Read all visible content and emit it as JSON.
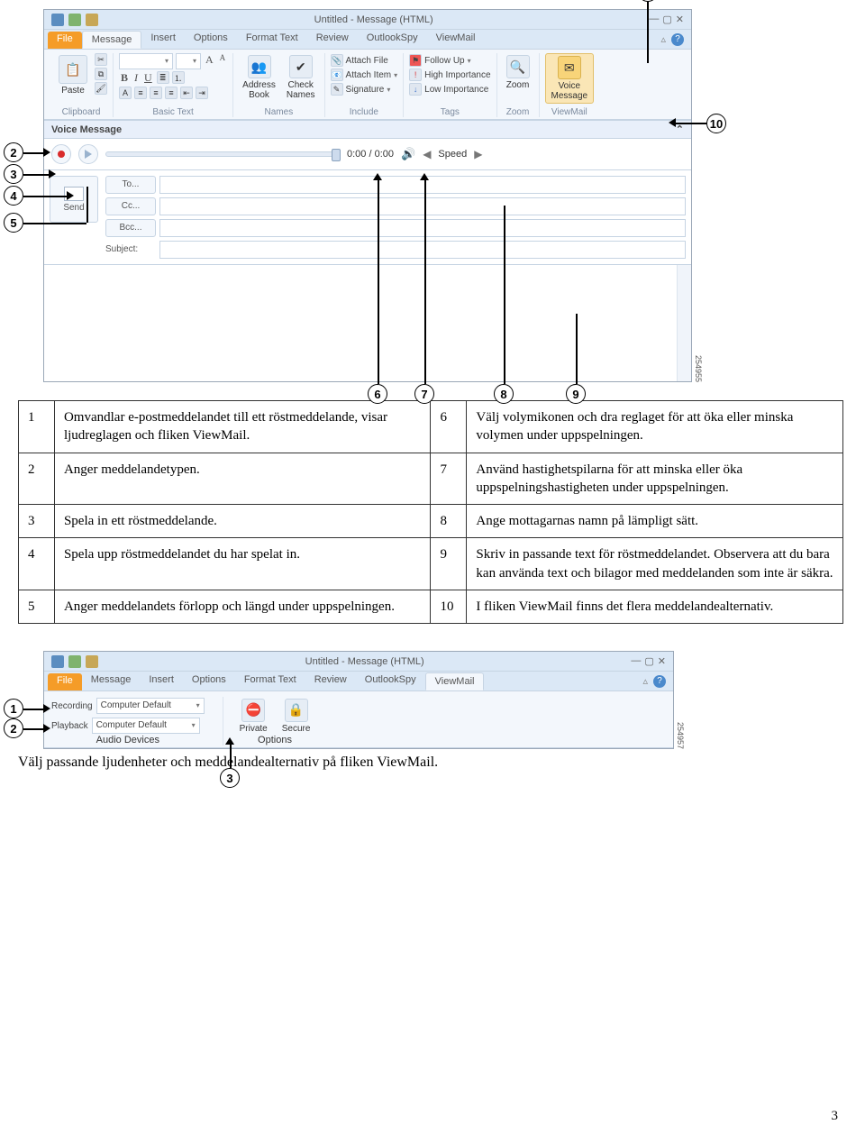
{
  "shot1": {
    "window_title": "Untitled - Message (HTML)",
    "tabs": {
      "file": "File",
      "message": "Message",
      "insert": "Insert",
      "options": "Options",
      "format_text": "Format Text",
      "review": "Review",
      "outlookspy": "OutlookSpy",
      "viewmail": "ViewMail"
    },
    "ribbon": {
      "clipboard": "Clipboard",
      "paste": "Paste",
      "basic_text": "Basic Text",
      "names": "Names",
      "address_book": "Address\nBook",
      "check_names": "Check\nNames",
      "include": "Include",
      "attach_file": "Attach File",
      "attach_item": "Attach Item",
      "signature": "Signature",
      "tags": "Tags",
      "follow_up": "Follow Up",
      "high_importance": "High Importance",
      "low_importance": "Low Importance",
      "zoom": "Zoom",
      "viewmail": "ViewMail",
      "voice_message": "Voice\nMessage"
    },
    "voice_header": "Voice Message",
    "player": {
      "time": "0:00 / 0:00",
      "speed": "Speed"
    },
    "fields": {
      "send": "Send",
      "to": "To...",
      "cc": "Cc...",
      "bcc": "Bcc...",
      "subject": "Subject:"
    },
    "image_id": "254955"
  },
  "legend": {
    "r1": {
      "n": "1",
      "t": "Omvandlar e-postmeddelandet till ett röstmeddelande, visar ljudreglagen och fliken ViewMail."
    },
    "r2": {
      "n": "2",
      "t": "Anger meddelandetypen."
    },
    "r3": {
      "n": "3",
      "t": "Spela in ett röstmeddelande."
    },
    "r4": {
      "n": "4",
      "t": "Spela upp röstmeddelandet du har spelat in."
    },
    "r5": {
      "n": "5",
      "t": "Anger meddelandets förlopp och längd under uppspelningen."
    },
    "r6": {
      "n": "6",
      "t": "Välj volymikonen och dra reglaget för att öka eller minska volymen under uppspelningen."
    },
    "r7": {
      "n": "7",
      "t": "Använd hastighetspilarna för att minska eller öka uppspelningshastigheten under uppspelningen."
    },
    "r8": {
      "n": "8",
      "t": "Ange mottagarnas namn på lämpligt sätt."
    },
    "r9": {
      "n": "9",
      "t": "Skriv in passande text för röstmeddelandet. Observera att du bara kan använda text och bilagor med meddelanden som inte är säkra."
    },
    "r10": {
      "n": "10",
      "t": "I fliken ViewMail finns det flera meddelandealternativ."
    }
  },
  "shot2": {
    "window_title": "Untitled - Message (HTML)",
    "tabs": {
      "file": "File",
      "message": "Message",
      "insert": "Insert",
      "options": "Options",
      "format_text": "Format Text",
      "review": "Review",
      "outlookspy": "OutlookSpy",
      "viewmail": "ViewMail"
    },
    "recording": "Recording",
    "playback": "Playback",
    "computer_default": "Computer Default",
    "audio_devices": "Audio Devices",
    "options": "Options",
    "private": "Private",
    "secure": "Secure",
    "image_id": "254957"
  },
  "caption": "Välj passande ljudenheter och meddelandealternativ på fliken ViewMail.",
  "page_number": "3"
}
